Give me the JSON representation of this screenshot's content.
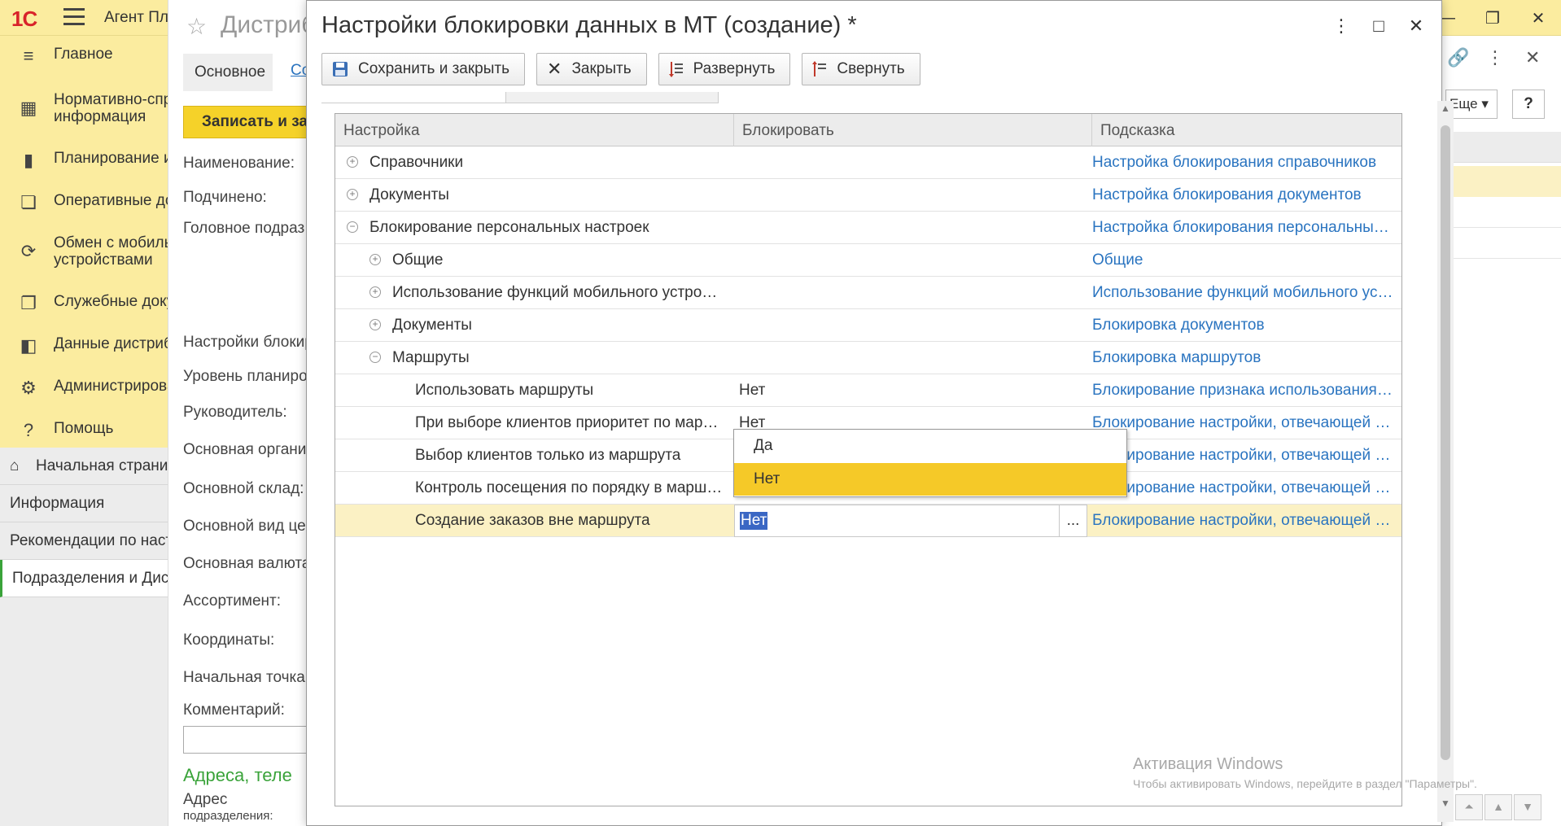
{
  "app": {
    "logo": "1С",
    "title": "Агент Пл",
    "colors": {
      "accent_yellow": "#fbec9f",
      "button_yellow": "#f5d229",
      "link_blue": "#2a74c0",
      "selection": "#fbf1c4",
      "highlight": "#f5c928"
    }
  },
  "sidebar": {
    "items": [
      {
        "icon": "menu-lines-icon",
        "label": "Главное"
      },
      {
        "icon": "table-icon",
        "label": "Нормативно-спр\nинформация"
      },
      {
        "icon": "bar-chart-icon",
        "label": "Планирование и"
      },
      {
        "icon": "documents-icon",
        "label": "Оперативные до"
      },
      {
        "icon": "sync-icon",
        "label": "Обмен с мобиль\nустройствами"
      },
      {
        "icon": "service-docs-icon",
        "label": "Служебные доку"
      },
      {
        "icon": "distributor-data-icon",
        "label": "Данные дистриб"
      },
      {
        "icon": "gear-icon",
        "label": "Администрирова"
      },
      {
        "icon": "question-icon",
        "label": "Помощь"
      }
    ],
    "open_windows": [
      {
        "label": "Начальная страни"
      },
      {
        "label": "Информация"
      },
      {
        "label": "Рекомендации по наст"
      },
      {
        "label": "Подразделения и Дист"
      }
    ]
  },
  "background_form": {
    "title": "Дистриб",
    "tab_main": "Основное",
    "tab_second": "Со",
    "save_button": "Записать и за",
    "labels": [
      "Наименование:",
      "Подчинено:",
      "Головное подраз",
      "Настройки блокир",
      "Уровень планиро",
      "Руководитель:",
      "Основная органи",
      "Основной склад:",
      "Основной вид це",
      "Основная валюта",
      "Ассортимент:",
      "Координаты:",
      "Начальная точка",
      "Комментарий:"
    ],
    "address_title": "Адреса, теле",
    "address_label": "Адрес",
    "address_label_2": "подразделения:",
    "more_button": "Еще",
    "help_button": "?"
  },
  "dialog": {
    "title": "Настройки блокировки данных в МТ (создание) *",
    "toolbar": {
      "save_close": "Сохранить и закрыть",
      "close": "Закрыть",
      "expand": "Развернуть",
      "collapse": "Свернуть"
    },
    "columns": {
      "setting": "Настройка",
      "block": "Блокировать",
      "hint": "Подсказка"
    },
    "rows": [
      {
        "level": 0,
        "toggle": "⊕",
        "name": "Справочники",
        "block": "",
        "hint": "Настройка блокирования справочников"
      },
      {
        "level": 0,
        "toggle": "⊕",
        "name": "Документы",
        "block": "",
        "hint": "Настройка блокирования документов"
      },
      {
        "level": 0,
        "toggle": "⊖",
        "name": "Блокирование персональных настроек",
        "block": "",
        "hint": "Настройка блокирования персональных…"
      },
      {
        "level": 1,
        "toggle": "⊕",
        "name": "Общие",
        "block": "",
        "hint": "Общие"
      },
      {
        "level": 1,
        "toggle": "⊕",
        "name": "Использование функций мобильного устро…",
        "block": "",
        "hint": "Использование функций мобильного ус…"
      },
      {
        "level": 1,
        "toggle": "⊕",
        "name": "Документы",
        "block": "",
        "hint": "Блокировка документов"
      },
      {
        "level": 1,
        "toggle": "⊖",
        "name": "Маршруты",
        "block": "",
        "hint": "Блокировка маршрутов"
      },
      {
        "level": 2,
        "toggle": "",
        "name": "Использовать маршруты",
        "block": "Нет",
        "hint": "Блокирование признака использования …"
      },
      {
        "level": 2,
        "toggle": "",
        "name": "При выборе клиентов приоритет по мар…",
        "block": "Нет",
        "hint": "Блокирование настройки, отвечающей з…"
      },
      {
        "level": 2,
        "toggle": "",
        "name": "Выбор клиентов только из маршрута",
        "block": "Нет",
        "hint": "Блокирование настройки, отвечающей з…"
      },
      {
        "level": 2,
        "toggle": "",
        "name": "Контроль посещения по порядку в марш…",
        "block": "Нет",
        "hint": "Блокирование настройки, отвечающей з…"
      },
      {
        "level": 2,
        "toggle": "",
        "name": "Создание заказов вне маршрута",
        "block": "",
        "hint": "Блокирование настройки, отвечающей …"
      }
    ],
    "editing": {
      "value": "Нет",
      "dots": "..."
    },
    "dropdown_options": [
      "Да",
      "Нет"
    ]
  },
  "watermark": {
    "line1": "Активация Windows",
    "line2": "Чтобы активировать Windows, перейдите в раздел \"Параметры\"."
  }
}
